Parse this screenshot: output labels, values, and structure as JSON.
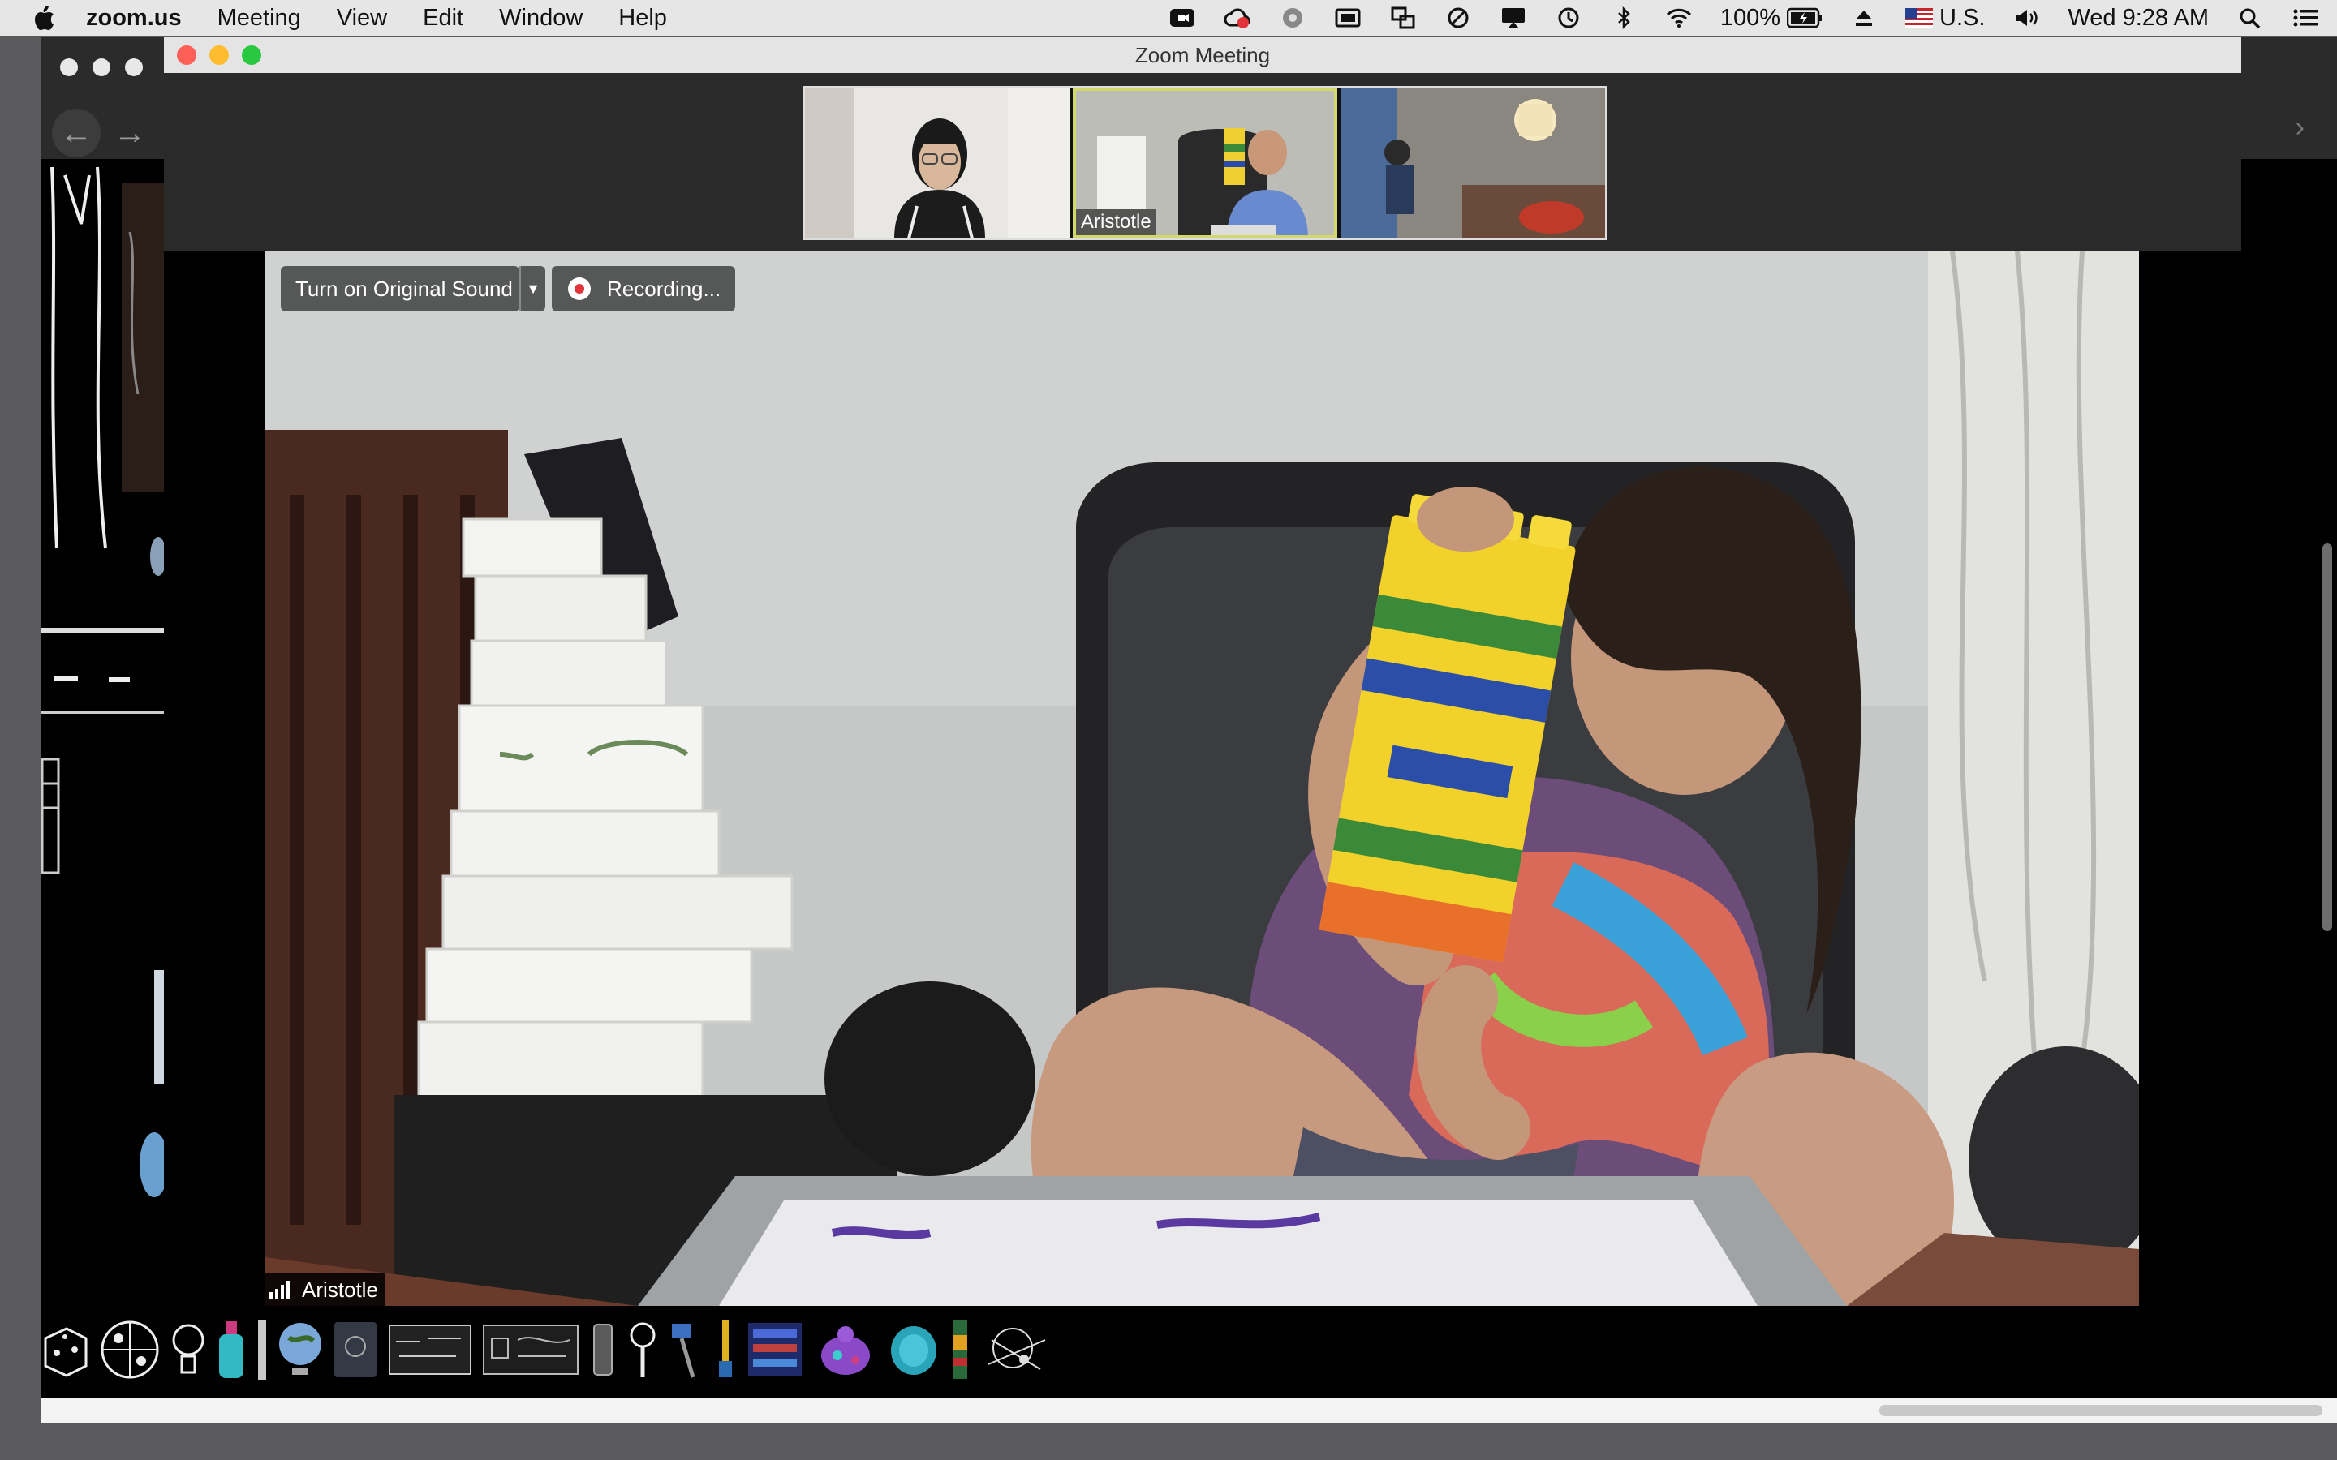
{
  "menubar": {
    "app": "zoom.us",
    "items": [
      "Meeting",
      "View",
      "Edit",
      "Window",
      "Help"
    ],
    "battery": "100%",
    "input_source": "U.S.",
    "clock": "Wed 9:28 AM"
  },
  "zoom": {
    "window_title": "Zoom Meeting",
    "thumbnails": [
      {
        "name": ""
      },
      {
        "name": "Aristotle"
      },
      {
        "name": ""
      }
    ],
    "original_sound_button": "Turn on Original Sound",
    "recording_label": "Recording...",
    "active_speaker": "Aristotle"
  },
  "colors": {
    "close": "#fe5f57",
    "minimize": "#febc2e",
    "zoom": "#28c840",
    "recording": "#e0343a",
    "active_speaker_border": "#d3d86a"
  }
}
